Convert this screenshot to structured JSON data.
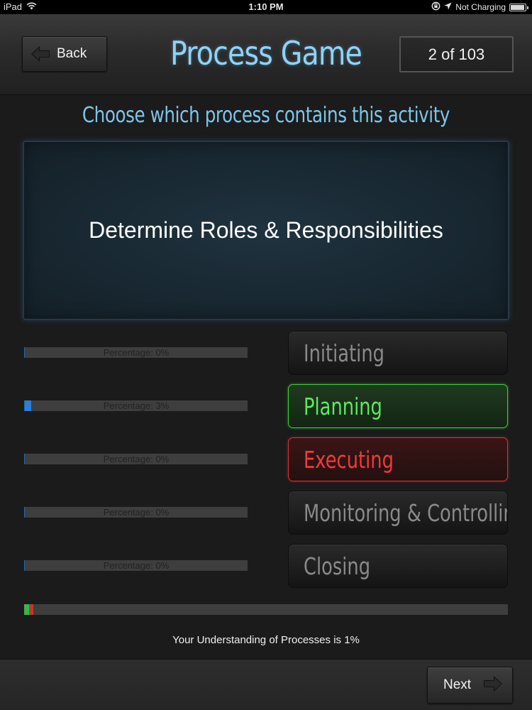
{
  "status_bar": {
    "device": "iPad",
    "time": "1:10 PM",
    "charging": "Not Charging"
  },
  "header": {
    "back_label": "Back",
    "title": "Process Game",
    "counter": "2 of 103"
  },
  "prompt": "Choose which process contains this activity",
  "activity": "Determine Roles & Responsibilities",
  "processes": [
    {
      "label": "Initiating",
      "percentage_text": "Percentage: 0%",
      "percentage": 0,
      "state": "default"
    },
    {
      "label": "Planning",
      "percentage_text": "Percentage: 3%",
      "percentage": 3,
      "state": "correct"
    },
    {
      "label": "Executing",
      "percentage_text": "Percentage: 0%",
      "percentage": 0,
      "state": "wrong"
    },
    {
      "label": "Monitoring & Controlling",
      "percentage_text": "Percentage: 0%",
      "percentage": 0,
      "state": "default"
    },
    {
      "label": "Closing",
      "percentage_text": "Percentage: 0%",
      "percentage": 0,
      "state": "default"
    }
  ],
  "overall_progress": {
    "correct_fraction": 0.01,
    "wrong_fraction": 0.009
  },
  "understanding_text": "Your Understanding of Processes is 1%",
  "footer": {
    "next_label": "Next"
  },
  "colors": {
    "title": "#8fd3f5",
    "correct": "#5ee85e",
    "wrong": "#f03a3a",
    "progress_fill": "#2b7fd6"
  }
}
